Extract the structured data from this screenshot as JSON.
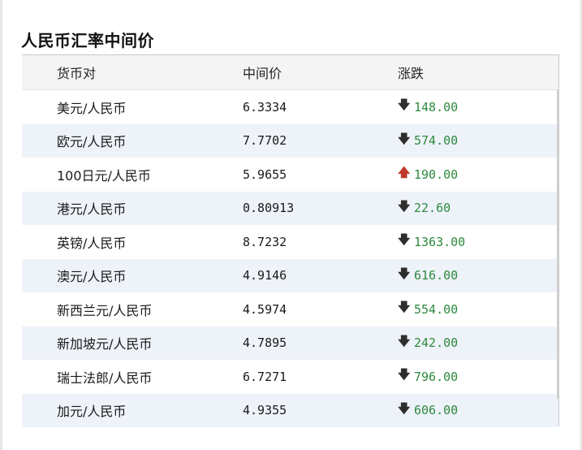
{
  "title": "人民币汇率中间价",
  "table": {
    "headers": [
      "货币对",
      "中间价",
      "涨跌"
    ],
    "rows": [
      {
        "pair": "美元/人民币",
        "mid": "6.3334",
        "direction": "down",
        "change": "148.00"
      },
      {
        "pair": "欧元/人民币",
        "mid": "7.7702",
        "direction": "down",
        "change": "574.00"
      },
      {
        "pair": "100日元/人民币",
        "mid": "5.9655",
        "direction": "up",
        "change": "190.00"
      },
      {
        "pair": "港元/人民币",
        "mid": "0.80913",
        "direction": "down",
        "change": "22.60"
      },
      {
        "pair": "英镑/人民币",
        "mid": "8.7232",
        "direction": "down",
        "change": "1363.00"
      },
      {
        "pair": "澳元/人民币",
        "mid": "4.9146",
        "direction": "down",
        "change": "616.00"
      },
      {
        "pair": "新西兰元/人民币",
        "mid": "4.5974",
        "direction": "down",
        "change": "554.00"
      },
      {
        "pair": "新加坡元/人民币",
        "mid": "4.7895",
        "direction": "down",
        "change": "242.00"
      },
      {
        "pair": "瑞士法郎/人民币",
        "mid": "6.7271",
        "direction": "down",
        "change": "796.00"
      },
      {
        "pair": "加元/人民币",
        "mid": "4.9355",
        "direction": "down",
        "change": "606.00"
      }
    ]
  },
  "icons": {
    "down": "arrow-down-icon",
    "up": "arrow-up-icon"
  },
  "colors": {
    "change_text": "#2d8a3e",
    "up_arrow": "#c0392b",
    "down_arrow": "#2e2e2e",
    "alt_row": "#eef2f9"
  }
}
